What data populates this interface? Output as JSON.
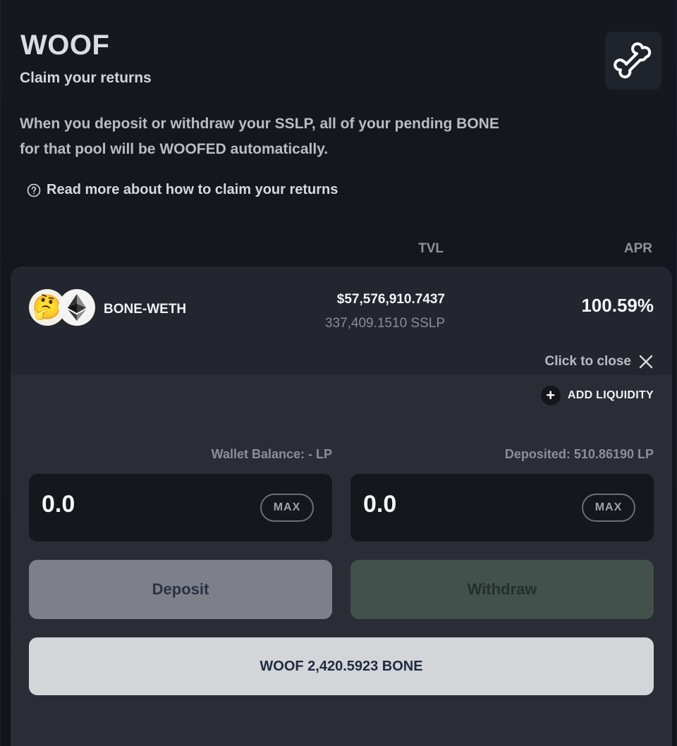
{
  "header": {
    "title": "WOOF",
    "subtitle": "Claim your returns",
    "bone_icon": "bone-icon"
  },
  "info": {
    "description_line1": "When you deposit or withdraw your SSLP, all of your pending BONE",
    "description_line2": "for that pool will be WOOFED automatically.",
    "help_link": "Read more about how to claim your returns",
    "help_icon": "question-circle-icon"
  },
  "columns": {
    "tvl": "TVL",
    "apr": "APR"
  },
  "pool": {
    "token_a_icon": "thinking-face-icon",
    "token_a_glyph": "🤔",
    "token_b_icon": "ethereum-icon",
    "name": "BONE-WETH",
    "tvl_usd": "$57,576,910.7437",
    "tvl_lp": "337,409.1510 SSLP",
    "apr": "100.59%",
    "close_label": "Click to close"
  },
  "panel": {
    "add_liquidity": "ADD LIQUIDITY",
    "wallet_balance": "Wallet Balance: - LP",
    "deposited": "Deposited: 510.86190 LP",
    "deposit_amount": "0.0",
    "withdraw_amount": "0.0",
    "max_label": "MAX",
    "deposit_label": "Deposit",
    "withdraw_label": "Withdraw",
    "woof_label": "WOOF 2,420.5923 BONE"
  },
  "colors": {
    "background": "#12141a",
    "card": "#23262e",
    "panel": "#2a2d36",
    "deposit_button": "#7d8088",
    "withdraw_button": "#42514b",
    "woof_button": "#d4d5d8"
  }
}
